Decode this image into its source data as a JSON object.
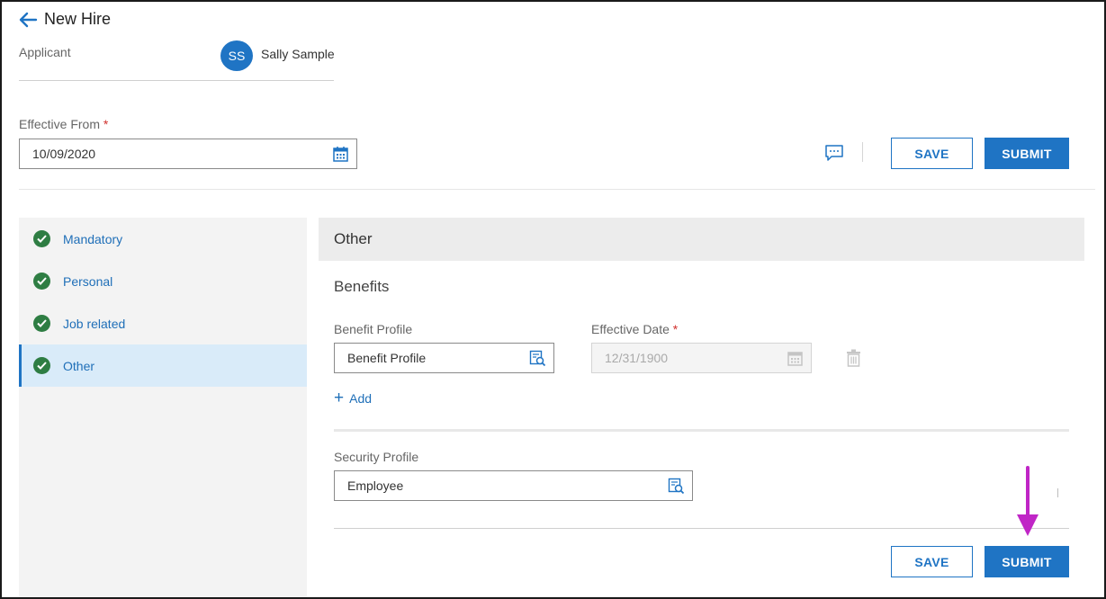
{
  "header": {
    "title": "New Hire",
    "applicant_label": "Applicant",
    "avatar_initials": "SS",
    "applicant_name": "Sally Sample",
    "effective_from_label": "Effective From",
    "required_marker": "*",
    "effective_from_value": "10/09/2020",
    "save_label": "SAVE",
    "submit_label": "SUBMIT"
  },
  "sidebar": {
    "items": [
      {
        "label": "Mandatory",
        "status": "complete",
        "active": false
      },
      {
        "label": "Personal",
        "status": "complete",
        "active": false
      },
      {
        "label": "Job related",
        "status": "complete",
        "active": false
      },
      {
        "label": "Other",
        "status": "complete",
        "active": true
      }
    ]
  },
  "main": {
    "section_title": "Other",
    "benefits_title": "Benefits",
    "benefit_profile_label": "Benefit Profile",
    "benefit_profile_value": "Benefit Profile",
    "effective_date_label": "Effective Date",
    "effective_date_value": "12/31/1900",
    "add_label": "Add",
    "security_profile_label": "Security Profile",
    "security_profile_value": "Employee",
    "save_label": "SAVE",
    "submit_label": "SUBMIT"
  },
  "icons": {
    "back": "arrow-left-icon",
    "calendar": "calendar-icon",
    "comment": "comment-icon",
    "lookup": "lookup-icon",
    "delete": "trash-icon",
    "check": "check-circle-icon",
    "annotation": "arrow-down-annotation"
  },
  "colors": {
    "accent": "#1f74c4",
    "success": "#2e7d43",
    "required": "#d0312d",
    "annotation": "#c026c6",
    "active_bg": "#d9ebf9"
  }
}
